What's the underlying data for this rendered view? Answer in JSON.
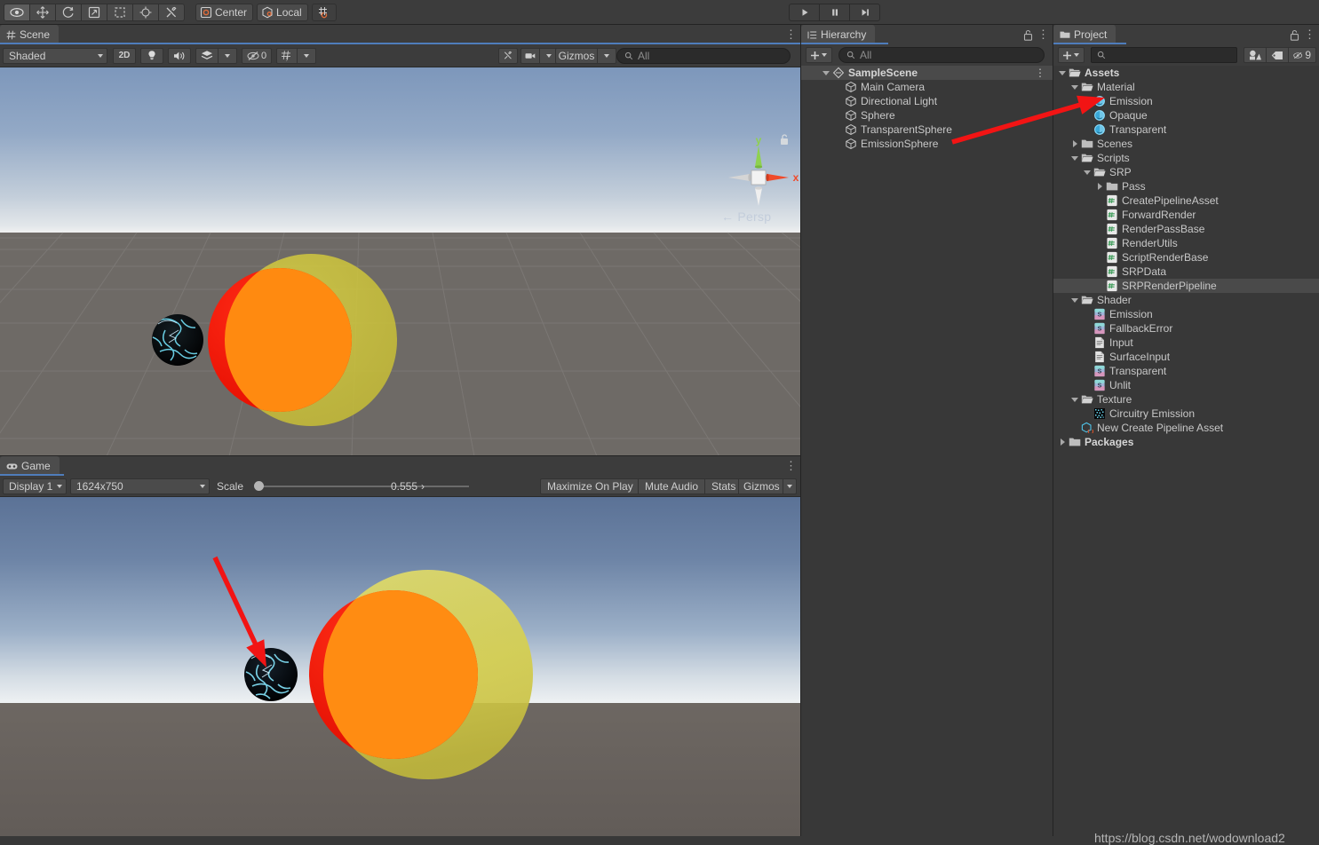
{
  "app": {
    "watermark": "https://blog.csdn.net/wodownload2"
  },
  "top_toolbar": {
    "tools": [
      {
        "name": "hand-tool",
        "icon": "eye",
        "selected": true
      },
      {
        "name": "move-tool",
        "icon": "move",
        "selected": false
      },
      {
        "name": "rotate-tool",
        "icon": "rotate",
        "selected": false
      },
      {
        "name": "scale-tool",
        "icon": "scale",
        "selected": false
      },
      {
        "name": "rect-tool",
        "icon": "rect",
        "selected": false
      },
      {
        "name": "transform-tool",
        "icon": "transform",
        "selected": false
      },
      {
        "name": "custom-tool",
        "icon": "wrench",
        "selected": false
      }
    ],
    "pivot_label": "Center",
    "handle_label": "Local",
    "grid_label": "",
    "play_controls": [
      {
        "name": "play-button",
        "glyph": "play"
      },
      {
        "name": "pause-button",
        "glyph": "pause"
      },
      {
        "name": "step-button",
        "glyph": "step"
      }
    ]
  },
  "scene": {
    "tab_label": "Scene",
    "draw_mode": "Shaded",
    "mode_2d": "2D",
    "hidden_count": "0",
    "gizmos_label": "Gizmos",
    "search_placeholder": "All",
    "search_value": "",
    "gizmo": {
      "y_label": "y",
      "x_label": "x",
      "persp_label": "Persp"
    }
  },
  "game": {
    "tab_label": "Game",
    "display": "Display 1",
    "resolution": "1624x750",
    "scale_label": "Scale",
    "scale_value": "0.555",
    "maximize_label": "Maximize On Play",
    "mute_label": "Mute Audio",
    "stats_label": "Stats",
    "gizmos_label": "Gizmos"
  },
  "hierarchy": {
    "tab_label": "Hierarchy",
    "search_placeholder": "All",
    "search_value": "",
    "items": [
      {
        "label": "SampleScene",
        "icon": "scene-icon",
        "depth": 0,
        "expanded": true,
        "selected": true,
        "bold": true
      },
      {
        "label": "Main Camera",
        "icon": "gameobject-icon",
        "depth": 1,
        "expanded": null,
        "selected": false,
        "bold": false
      },
      {
        "label": "Directional Light",
        "icon": "gameobject-icon",
        "depth": 1,
        "expanded": null,
        "selected": false,
        "bold": false
      },
      {
        "label": "Sphere",
        "icon": "gameobject-icon",
        "depth": 1,
        "expanded": null,
        "selected": false,
        "bold": false
      },
      {
        "label": "TransparentSphere",
        "icon": "gameobject-icon",
        "depth": 1,
        "expanded": null,
        "selected": false,
        "bold": false
      },
      {
        "label": "EmissionSphere",
        "icon": "gameobject-icon",
        "depth": 1,
        "expanded": null,
        "selected": false,
        "bold": false
      }
    ]
  },
  "project": {
    "tab_label": "Project",
    "search_placeholder": "",
    "search_value": "",
    "filter_badge": "9",
    "items": [
      {
        "label": "Assets",
        "icon": "folder-open-icon",
        "depth": 0,
        "expanded": true,
        "selected": false,
        "bold": true
      },
      {
        "label": "Material",
        "icon": "folder-open-icon",
        "depth": 1,
        "expanded": true,
        "selected": false,
        "bold": false
      },
      {
        "label": "Emission",
        "icon": "material-icon",
        "depth": 2,
        "expanded": null,
        "selected": false,
        "bold": false
      },
      {
        "label": "Opaque",
        "icon": "material-icon",
        "depth": 2,
        "expanded": null,
        "selected": false,
        "bold": false
      },
      {
        "label": "Transparent",
        "icon": "material-icon",
        "depth": 2,
        "expanded": null,
        "selected": false,
        "bold": false
      },
      {
        "label": "Scenes",
        "icon": "folder-icon",
        "depth": 1,
        "expanded": false,
        "selected": false,
        "bold": false
      },
      {
        "label": "Scripts",
        "icon": "folder-open-icon",
        "depth": 1,
        "expanded": true,
        "selected": false,
        "bold": false
      },
      {
        "label": "SRP",
        "icon": "folder-open-icon",
        "depth": 2,
        "expanded": true,
        "selected": false,
        "bold": false
      },
      {
        "label": "Pass",
        "icon": "folder-icon",
        "depth": 3,
        "expanded": false,
        "selected": false,
        "bold": false
      },
      {
        "label": "CreatePipelineAsset",
        "icon": "script-icon",
        "depth": 3,
        "expanded": null,
        "selected": false,
        "bold": false
      },
      {
        "label": "ForwardRender",
        "icon": "script-icon",
        "depth": 3,
        "expanded": null,
        "selected": false,
        "bold": false
      },
      {
        "label": "RenderPassBase",
        "icon": "script-icon",
        "depth": 3,
        "expanded": null,
        "selected": false,
        "bold": false
      },
      {
        "label": "RenderUtils",
        "icon": "script-icon",
        "depth": 3,
        "expanded": null,
        "selected": false,
        "bold": false
      },
      {
        "label": "ScriptRenderBase",
        "icon": "script-icon",
        "depth": 3,
        "expanded": null,
        "selected": false,
        "bold": false
      },
      {
        "label": "SRPData",
        "icon": "script-icon",
        "depth": 3,
        "expanded": null,
        "selected": false,
        "bold": false
      },
      {
        "label": "SRPRenderPipeline",
        "icon": "script-icon",
        "depth": 3,
        "expanded": null,
        "selected": true,
        "bold": false
      },
      {
        "label": "Shader",
        "icon": "folder-open-icon",
        "depth": 1,
        "expanded": true,
        "selected": false,
        "bold": false
      },
      {
        "label": "Emission",
        "icon": "shader-icon",
        "depth": 2,
        "expanded": null,
        "selected": false,
        "bold": false
      },
      {
        "label": "FallbackError",
        "icon": "shader-icon",
        "depth": 2,
        "expanded": null,
        "selected": false,
        "bold": false
      },
      {
        "label": "Input",
        "icon": "text-icon",
        "depth": 2,
        "expanded": null,
        "selected": false,
        "bold": false
      },
      {
        "label": "SurfaceInput",
        "icon": "text-icon",
        "depth": 2,
        "expanded": null,
        "selected": false,
        "bold": false
      },
      {
        "label": "Transparent",
        "icon": "shader-icon",
        "depth": 2,
        "expanded": null,
        "selected": false,
        "bold": false
      },
      {
        "label": "Unlit",
        "icon": "shader-icon",
        "depth": 2,
        "expanded": null,
        "selected": false,
        "bold": false
      },
      {
        "label": "Texture",
        "icon": "folder-open-icon",
        "depth": 1,
        "expanded": true,
        "selected": false,
        "bold": false
      },
      {
        "label": "Circuitry Emission",
        "icon": "texture-icon",
        "depth": 2,
        "expanded": null,
        "selected": false,
        "bold": false
      },
      {
        "label": "New Create Pipeline Asset",
        "icon": "asset-icon",
        "depth": 1,
        "expanded": null,
        "selected": false,
        "bold": false
      },
      {
        "label": "Packages",
        "icon": "folder-icon",
        "depth": 0,
        "expanded": false,
        "selected": false,
        "bold": true
      }
    ]
  },
  "annotations": {
    "arrow_color": "#f21414",
    "arrows": [
      {
        "name": "hierarchy-to-material-arrow",
        "from": [
          1072,
          160
        ],
        "to": [
          1244,
          110
        ]
      },
      {
        "name": "game-emission-sphere-arrow",
        "from": [
          242,
          628
        ],
        "to": [
          300,
          752
        ]
      }
    ]
  }
}
